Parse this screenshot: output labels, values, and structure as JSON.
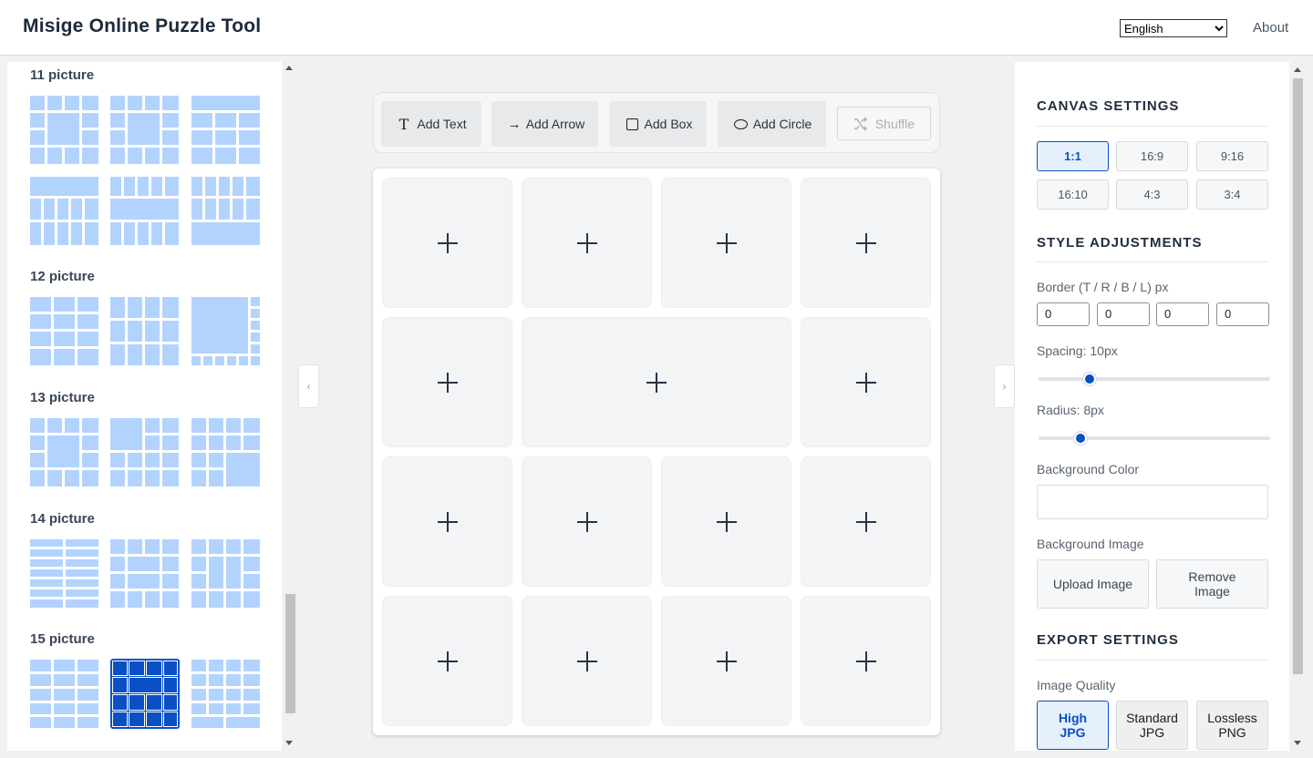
{
  "header": {
    "title": "Misige Online Puzzle Tool",
    "language": "English",
    "about": "About"
  },
  "left_panel": {
    "groups": [
      {
        "label": "11 picture"
      },
      {
        "label": "12 picture"
      },
      {
        "label": "13 picture"
      },
      {
        "label": "14 picture"
      },
      {
        "label": "15 picture"
      }
    ],
    "selected_template": "15 picture, layout 2",
    "collapse_icon": "chevron-left-icon"
  },
  "toolbar": {
    "add_text": "Add Text",
    "add_arrow": "Add Arrow",
    "add_box": "Add Box",
    "add_circle": "Add Circle",
    "shuffle": "Shuffle",
    "icons": {
      "text": "T",
      "arrow": "→",
      "box": "□",
      "circle": "○",
      "shuffle": "shuffle-icon"
    }
  },
  "canvas": {
    "cell_count": 15,
    "cell_icon": "plus-icon"
  },
  "right_panel": {
    "canvas_settings_title": "CANVAS SETTINGS",
    "ratios": [
      "1:1",
      "16:9",
      "9:16",
      "16:10",
      "4:3",
      "3:4"
    ],
    "selected_ratio": "1:1",
    "style_title": "STYLE ADJUSTMENTS",
    "border_label": "Border (T / R / B / L) px",
    "border_values": [
      "0",
      "0",
      "0",
      "0"
    ],
    "spacing_label": "Spacing: 10px",
    "spacing_fraction": 0.22,
    "radius_label": "Radius: 8px",
    "radius_fraction": 0.18,
    "bg_color_label": "Background Color",
    "bg_image_label": "Background Image",
    "upload_image": "Upload Image",
    "remove_image": "Remove Image",
    "export_title": "EXPORT SETTINGS",
    "quality_label": "Image Quality",
    "qualities": [
      "High JPG",
      "Standard JPG",
      "Lossless PNG"
    ],
    "selected_quality": "High JPG"
  },
  "colors": {
    "accent": "#0a4fc4",
    "template_cell": "#b3d3ff",
    "canvas_cell": "#f3f4f6"
  }
}
